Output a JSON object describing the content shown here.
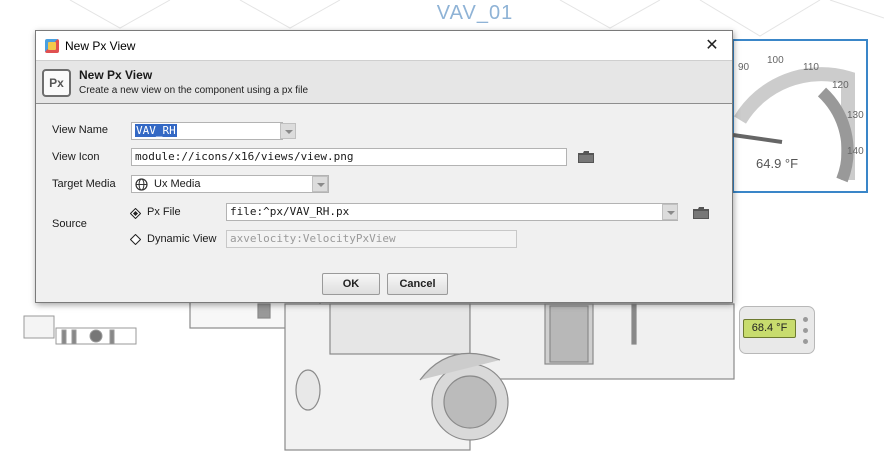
{
  "background": {
    "graphic_title": "VAV_01",
    "gauge_ticks": [
      "90",
      "100",
      "110",
      "120",
      "130",
      "140"
    ],
    "gauge_value": "64.9 °F",
    "thermostat_value": "68.4 °F"
  },
  "dialog": {
    "window_title": "New Px View",
    "header_title": "New Px View",
    "header_subtitle": "Create a new view on the component using a px file",
    "px_badge": "Px",
    "fields": {
      "view_name_label": "View Name",
      "view_name_value": "VAV_RH",
      "view_icon_label": "View Icon",
      "view_icon_value": "module://icons/x16/views/view.png",
      "target_media_label": "Target Media",
      "target_media_value": "Ux Media",
      "source_label": "Source",
      "px_file_label": "Px File",
      "px_file_value": "file:^px/VAV_RH.px",
      "dynamic_view_label": "Dynamic View",
      "dynamic_view_value": "axvelocity:VelocityPxView"
    },
    "source_selected": "px_file",
    "buttons": {
      "ok": "OK",
      "cancel": "Cancel"
    }
  },
  "icons": [
    "app-icon",
    "close-icon",
    "px-icon",
    "folder-icon",
    "globe-icon",
    "radio-icon",
    "dropdown-arrow-icon"
  ]
}
